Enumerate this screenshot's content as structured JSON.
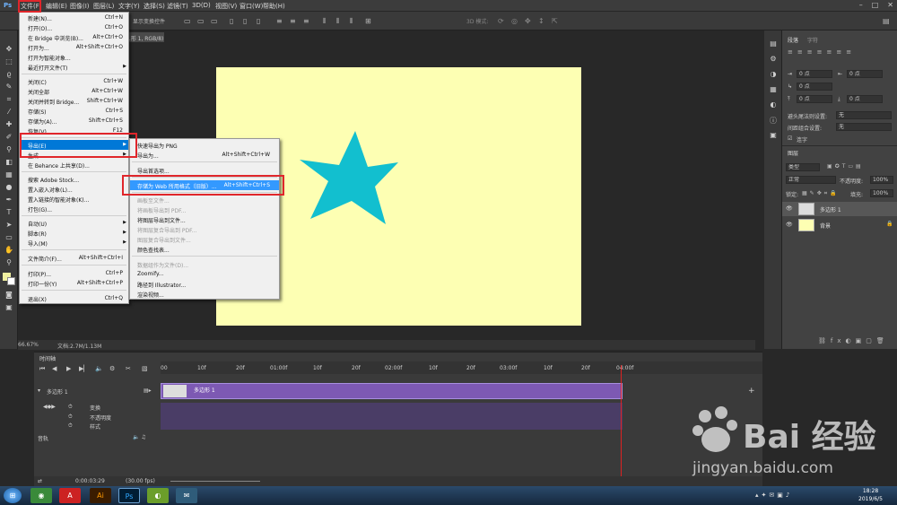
{
  "menubar": {
    "items": [
      "文件(F)",
      "编辑(E)",
      "图像(I)",
      "图层(L)",
      "文字(Y)",
      "选择(S)",
      "滤镜(T)",
      "3D(D)",
      "视图(V)",
      "窗口(W)",
      "帮助(H)"
    ]
  },
  "options": {
    "transform_label": "显示变换控件",
    "mode_label": "3D 模式:"
  },
  "document": {
    "tab": "...形 1, RGB/8) *"
  },
  "file_menu": {
    "items": [
      {
        "label": "新建(N)...",
        "shortcut": "Ctrl+N"
      },
      {
        "label": "打开(O)...",
        "shortcut": "Ctrl+O"
      },
      {
        "label": "在 Bridge 中浏览(B)...",
        "shortcut": "Alt+Ctrl+O"
      },
      {
        "label": "打开为...",
        "shortcut": "Alt+Shift+Ctrl+O"
      },
      {
        "label": "打开为智能对象...",
        "shortcut": ""
      },
      {
        "label": "最近打开文件(T)",
        "shortcut": ""
      },
      {
        "label": "关闭(C)",
        "shortcut": "Ctrl+W"
      },
      {
        "label": "关闭全部",
        "shortcut": "Alt+Ctrl+W"
      },
      {
        "label": "关闭并转到 Bridge...",
        "shortcut": "Shift+Ctrl+W"
      },
      {
        "label": "存储(S)",
        "shortcut": "Ctrl+S"
      },
      {
        "label": "存储为(A)...",
        "shortcut": "Shift+Ctrl+S"
      },
      {
        "label": "恢复(V)",
        "shortcut": "F12"
      },
      {
        "label": "导出(E)",
        "shortcut": ""
      },
      {
        "label": "生成",
        "shortcut": ""
      },
      {
        "label": "在 Behance 上共享(D)...",
        "shortcut": ""
      },
      {
        "label": "搜索 Adobe Stock...",
        "shortcut": ""
      },
      {
        "label": "置入嵌入对象(L)...",
        "shortcut": ""
      },
      {
        "label": "置入链接的智能对象(K)...",
        "shortcut": ""
      },
      {
        "label": "打包(G)...",
        "shortcut": ""
      },
      {
        "label": "自动(U)",
        "shortcut": ""
      },
      {
        "label": "脚本(R)",
        "shortcut": ""
      },
      {
        "label": "导入(M)",
        "shortcut": ""
      },
      {
        "label": "文件简介(F)...",
        "shortcut": "Alt+Shift+Ctrl+I"
      },
      {
        "label": "打印(P)...",
        "shortcut": "Ctrl+P"
      },
      {
        "label": "打印一份(Y)",
        "shortcut": "Alt+Shift+Ctrl+P"
      },
      {
        "label": "退出(X)",
        "shortcut": "Ctrl+Q"
      }
    ]
  },
  "export_menu": {
    "items": [
      {
        "label": "快速导出为 PNG",
        "shortcut": ""
      },
      {
        "label": "导出为...",
        "shortcut": "Alt+Shift+Ctrl+W"
      },
      {
        "label": "导出首选项...",
        "shortcut": ""
      },
      {
        "label": "存储为 Web 所用格式（旧版）...",
        "shortcut": "Alt+Shift+Ctrl+S"
      },
      {
        "label": "画板至文件...",
        "shortcut": ""
      },
      {
        "label": "将画板导出到 PDF...",
        "shortcut": ""
      },
      {
        "label": "将图层导出到文件...",
        "shortcut": ""
      },
      {
        "label": "将图层复合导出到 PDF...",
        "shortcut": ""
      },
      {
        "label": "图层复合导出到文件...",
        "shortcut": ""
      },
      {
        "label": "颜色查找表...",
        "shortcut": ""
      },
      {
        "label": "数据组作为文件(D)...",
        "shortcut": ""
      },
      {
        "label": "Zoomify...",
        "shortcut": ""
      },
      {
        "label": "路径到 Illustrator...",
        "shortcut": ""
      },
      {
        "label": "渲染视频...",
        "shortcut": ""
      }
    ]
  },
  "status": {
    "zoom": "66.67%",
    "doc": "文档:2.7M/1.13M"
  },
  "char_panel": {
    "tabs": [
      "段落",
      "字符"
    ],
    "fields": [
      "0 点",
      "0 点",
      "0 点",
      "0 点",
      "0 点"
    ],
    "avoid_label": "避头尾法则设置:",
    "avoid_value": "无",
    "spacing_label": "间距组合设置:",
    "spacing_value": "无",
    "hyphen_label": "连字"
  },
  "layers_panel": {
    "title": "图层",
    "filter": "类型",
    "blend": "正常",
    "opacity_label": "不透明度:",
    "opacity": "100%",
    "lock_label": "锁定:",
    "fill_label": "填充:",
    "fill": "100%",
    "layers": [
      {
        "name": "多边形 1"
      },
      {
        "name": "背景"
      }
    ]
  },
  "timeline": {
    "title": "时间轴",
    "ticks": [
      "00",
      "10f",
      "20f",
      "01:00f",
      "10f",
      "20f",
      "02:00f",
      "10f",
      "20f",
      "03:00f",
      "10f",
      "20f",
      "04:00f"
    ],
    "layer_name": "多边形 1",
    "clip_label": "多边形 1",
    "props": [
      "变换",
      "不透明度",
      "样式"
    ],
    "audio_label": "音轨",
    "timecode": "0:00:03:29",
    "fps": "(30.00 fps)"
  },
  "taskbar": {
    "time": "18:28",
    "date": "2019/6/5"
  },
  "watermark": {
    "text": "Bai 经验",
    "url": "jingyan.baidu.com"
  },
  "colors": {
    "canvas": "#fdffb3",
    "star": "#12bfcf",
    "highlight": "#3399ff",
    "callout": "#e0262b",
    "track": "#7d59b3"
  }
}
